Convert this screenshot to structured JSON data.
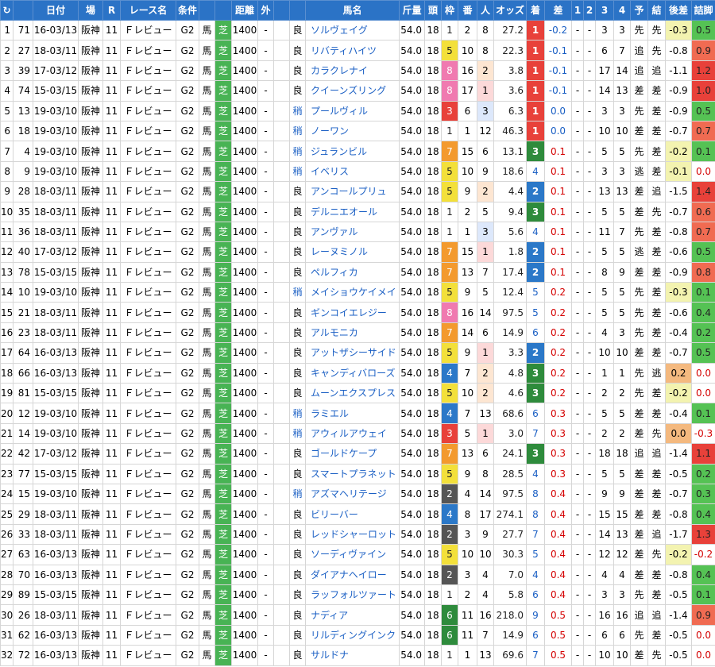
{
  "header": {
    "refresh_icon": "↻",
    "cols": [
      "",
      "日付",
      "場",
      "R",
      "レース名",
      "条件",
      "",
      "",
      "距離",
      "外",
      "",
      "馬名",
      "斤量",
      "頭",
      "枠",
      "番",
      "人",
      "オッズ",
      "着",
      "差",
      "1",
      "2",
      "3",
      "4",
      "予",
      "結",
      "後差",
      "詰脚"
    ]
  },
  "colors": {
    "header_bg": "#2b73c6",
    "turf": "#48b354",
    "win": "#e8413a",
    "place2": "#2b78c8",
    "place3": "#2e8b3c"
  },
  "rows": [
    [
      "1",
      "71",
      "16-03/13",
      "阪神",
      "11",
      "Ｆレビュー",
      "G2",
      "馬",
      "芝",
      "1400",
      "-",
      "",
      "良",
      "ソルヴェイグ",
      "54.0",
      "18",
      "1",
      "2",
      "8",
      "27.2",
      "1",
      "-0.2",
      "-",
      "-",
      "3",
      "3",
      "先",
      "先",
      "-0.3",
      "0.5"
    ],
    [
      "2",
      "27",
      "18-03/11",
      "阪神",
      "11",
      "Ｆレビュー",
      "G2",
      "馬",
      "芝",
      "1400",
      "-",
      "",
      "良",
      "リバティハイツ",
      "54.0",
      "18",
      "5",
      "10",
      "8",
      "22.3",
      "1",
      "-0.1",
      "-",
      "-",
      "6",
      "7",
      "追",
      "先",
      "-0.8",
      "0.9"
    ],
    [
      "3",
      "39",
      "17-03/12",
      "阪神",
      "11",
      "Ｆレビュー",
      "G2",
      "馬",
      "芝",
      "1400",
      "-",
      "",
      "良",
      "カラクレナイ",
      "54.0",
      "18",
      "8",
      "16",
      "2",
      "3.8",
      "1",
      "-0.1",
      "-",
      "-",
      "17",
      "14",
      "追",
      "追",
      "-1.1",
      "1.2"
    ],
    [
      "4",
      "74",
      "15-03/15",
      "阪神",
      "11",
      "Ｆレビュー",
      "G2",
      "馬",
      "芝",
      "1400",
      "-",
      "",
      "良",
      "クイーンズリング",
      "54.0",
      "18",
      "8",
      "17",
      "1",
      "3.6",
      "1",
      "-0.1",
      "-",
      "-",
      "14",
      "13",
      "差",
      "差",
      "-0.9",
      "1.0"
    ],
    [
      "5",
      "13",
      "19-03/10",
      "阪神",
      "11",
      "Ｆレビュー",
      "G2",
      "馬",
      "芝",
      "1400",
      "-",
      "",
      "稍",
      "プールヴィル",
      "54.0",
      "18",
      "3",
      "6",
      "3",
      "6.3",
      "1",
      "0.0",
      "-",
      "-",
      "3",
      "3",
      "先",
      "差",
      "-0.9",
      "0.5"
    ],
    [
      "6",
      "18",
      "19-03/10",
      "阪神",
      "11",
      "Ｆレビュー",
      "G2",
      "馬",
      "芝",
      "1400",
      "-",
      "",
      "稍",
      "ノーワン",
      "54.0",
      "18",
      "1",
      "1",
      "12",
      "46.3",
      "1",
      "0.0",
      "-",
      "-",
      "10",
      "10",
      "差",
      "差",
      "-0.7",
      "0.7"
    ],
    [
      "7",
      "4",
      "19-03/10",
      "阪神",
      "11",
      "Ｆレビュー",
      "G2",
      "馬",
      "芝",
      "1400",
      "-",
      "",
      "稍",
      "ジュランビル",
      "54.0",
      "18",
      "7",
      "15",
      "6",
      "13.1",
      "3",
      "0.1",
      "-",
      "-",
      "5",
      "5",
      "先",
      "差",
      "-0.2",
      "0.1"
    ],
    [
      "8",
      "9",
      "19-03/10",
      "阪神",
      "11",
      "Ｆレビュー",
      "G2",
      "馬",
      "芝",
      "1400",
      "-",
      "",
      "稍",
      "イベリス",
      "54.0",
      "18",
      "5",
      "10",
      "9",
      "18.6",
      "4",
      "0.1",
      "-",
      "-",
      "3",
      "3",
      "逃",
      "差",
      "-0.1",
      "0.0"
    ],
    [
      "9",
      "28",
      "18-03/11",
      "阪神",
      "11",
      "Ｆレビュー",
      "G2",
      "馬",
      "芝",
      "1400",
      "-",
      "",
      "良",
      "アンコールプリュ",
      "54.0",
      "18",
      "5",
      "9",
      "2",
      "4.4",
      "2",
      "0.1",
      "-",
      "-",
      "13",
      "13",
      "差",
      "追",
      "-1.5",
      "1.4"
    ],
    [
      "10",
      "35",
      "18-03/11",
      "阪神",
      "11",
      "Ｆレビュー",
      "G2",
      "馬",
      "芝",
      "1400",
      "-",
      "",
      "良",
      "デルニエオール",
      "54.0",
      "18",
      "1",
      "2",
      "5",
      "9.4",
      "3",
      "0.1",
      "-",
      "-",
      "5",
      "5",
      "差",
      "先",
      "-0.7",
      "0.6"
    ],
    [
      "11",
      "36",
      "18-03/11",
      "阪神",
      "11",
      "Ｆレビュー",
      "G2",
      "馬",
      "芝",
      "1400",
      "-",
      "",
      "良",
      "アンヴァル",
      "54.0",
      "18",
      "1",
      "1",
      "3",
      "5.6",
      "4",
      "0.1",
      "-",
      "-",
      "11",
      "7",
      "先",
      "差",
      "-0.8",
      "0.7"
    ],
    [
      "12",
      "40",
      "17-03/12",
      "阪神",
      "11",
      "Ｆレビュー",
      "G2",
      "馬",
      "芝",
      "1400",
      "-",
      "",
      "良",
      "レーヌミノル",
      "54.0",
      "18",
      "7",
      "15",
      "1",
      "1.8",
      "2",
      "0.1",
      "-",
      "-",
      "5",
      "5",
      "逃",
      "差",
      "-0.6",
      "0.5"
    ],
    [
      "13",
      "78",
      "15-03/15",
      "阪神",
      "11",
      "Ｆレビュー",
      "G2",
      "馬",
      "芝",
      "1400",
      "-",
      "",
      "良",
      "ペルフィカ",
      "54.0",
      "18",
      "7",
      "13",
      "7",
      "17.4",
      "2",
      "0.1",
      "-",
      "-",
      "8",
      "9",
      "差",
      "差",
      "-0.9",
      "0.8"
    ],
    [
      "14",
      "10",
      "19-03/10",
      "阪神",
      "11",
      "Ｆレビュー",
      "G2",
      "馬",
      "芝",
      "1400",
      "-",
      "",
      "稍",
      "メイショウケイメイ",
      "54.0",
      "18",
      "5",
      "9",
      "5",
      "12.4",
      "5",
      "0.2",
      "-",
      "-",
      "5",
      "5",
      "先",
      "差",
      "-0.3",
      "0.1"
    ],
    [
      "15",
      "21",
      "18-03/11",
      "阪神",
      "11",
      "Ｆレビュー",
      "G2",
      "馬",
      "芝",
      "1400",
      "-",
      "",
      "良",
      "ギンコイエレジー",
      "54.0",
      "18",
      "8",
      "16",
      "14",
      "97.5",
      "5",
      "0.2",
      "-",
      "-",
      "5",
      "5",
      "先",
      "差",
      "-0.6",
      "0.4"
    ],
    [
      "16",
      "23",
      "18-03/11",
      "阪神",
      "11",
      "Ｆレビュー",
      "G2",
      "馬",
      "芝",
      "1400",
      "-",
      "",
      "良",
      "アルモニカ",
      "54.0",
      "18",
      "7",
      "14",
      "6",
      "14.9",
      "6",
      "0.2",
      "-",
      "-",
      "4",
      "3",
      "先",
      "差",
      "-0.4",
      "0.2"
    ],
    [
      "17",
      "64",
      "16-03/13",
      "阪神",
      "11",
      "Ｆレビュー",
      "G2",
      "馬",
      "芝",
      "1400",
      "-",
      "",
      "良",
      "アットザシーサイド",
      "54.0",
      "18",
      "5",
      "9",
      "1",
      "3.3",
      "2",
      "0.2",
      "-",
      "-",
      "10",
      "10",
      "差",
      "差",
      "-0.7",
      "0.5"
    ],
    [
      "18",
      "66",
      "16-03/13",
      "阪神",
      "11",
      "Ｆレビュー",
      "G2",
      "馬",
      "芝",
      "1400",
      "-",
      "",
      "良",
      "キャンディバローズ",
      "54.0",
      "18",
      "4",
      "7",
      "2",
      "4.8",
      "3",
      "0.2",
      "-",
      "-",
      "1",
      "1",
      "先",
      "逃",
      "0.2",
      "0.0"
    ],
    [
      "19",
      "81",
      "15-03/15",
      "阪神",
      "11",
      "Ｆレビュー",
      "G2",
      "馬",
      "芝",
      "1400",
      "-",
      "",
      "良",
      "ムーンエクスプレス",
      "54.0",
      "18",
      "5",
      "10",
      "2",
      "4.6",
      "3",
      "0.2",
      "-",
      "-",
      "2",
      "2",
      "先",
      "差",
      "-0.2",
      "0.0"
    ],
    [
      "20",
      "12",
      "19-03/10",
      "阪神",
      "11",
      "Ｆレビュー",
      "G2",
      "馬",
      "芝",
      "1400",
      "-",
      "",
      "稍",
      "ラミエル",
      "54.0",
      "18",
      "4",
      "7",
      "13",
      "68.6",
      "6",
      "0.3",
      "-",
      "-",
      "5",
      "5",
      "差",
      "差",
      "-0.4",
      "0.1"
    ],
    [
      "21",
      "14",
      "19-03/10",
      "阪神",
      "11",
      "Ｆレビュー",
      "G2",
      "馬",
      "芝",
      "1400",
      "-",
      "",
      "稍",
      "アウィルアウェイ",
      "54.0",
      "18",
      "3",
      "5",
      "1",
      "3.0",
      "7",
      "0.3",
      "-",
      "-",
      "2",
      "2",
      "差",
      "先",
      "0.0",
      "-0.3"
    ],
    [
      "22",
      "42",
      "17-03/12",
      "阪神",
      "11",
      "Ｆレビュー",
      "G2",
      "馬",
      "芝",
      "1400",
      "-",
      "",
      "良",
      "ゴールドケープ",
      "54.0",
      "18",
      "7",
      "13",
      "6",
      "24.1",
      "3",
      "0.3",
      "-",
      "-",
      "18",
      "18",
      "追",
      "追",
      "-1.4",
      "1.1"
    ],
    [
      "23",
      "77",
      "15-03/15",
      "阪神",
      "11",
      "Ｆレビュー",
      "G2",
      "馬",
      "芝",
      "1400",
      "-",
      "",
      "良",
      "スマートプラネット",
      "54.0",
      "18",
      "5",
      "9",
      "8",
      "28.5",
      "4",
      "0.3",
      "-",
      "-",
      "5",
      "5",
      "差",
      "差",
      "-0.5",
      "0.2"
    ],
    [
      "24",
      "15",
      "19-03/10",
      "阪神",
      "11",
      "Ｆレビュー",
      "G2",
      "馬",
      "芝",
      "1400",
      "-",
      "",
      "稍",
      "アズマヘリテージ",
      "54.0",
      "18",
      "2",
      "4",
      "14",
      "97.5",
      "8",
      "0.4",
      "-",
      "-",
      "9",
      "9",
      "差",
      "差",
      "-0.7",
      "0.3"
    ],
    [
      "25",
      "29",
      "18-03/11",
      "阪神",
      "11",
      "Ｆレビュー",
      "G2",
      "馬",
      "芝",
      "1400",
      "-",
      "",
      "良",
      "ビリーバー",
      "54.0",
      "18",
      "4",
      "8",
      "17",
      "274.1",
      "8",
      "0.4",
      "-",
      "-",
      "15",
      "15",
      "差",
      "差",
      "-0.8",
      "0.4"
    ],
    [
      "26",
      "33",
      "18-03/11",
      "阪神",
      "11",
      "Ｆレビュー",
      "G2",
      "馬",
      "芝",
      "1400",
      "-",
      "",
      "良",
      "レッドシャーロット",
      "54.0",
      "18",
      "2",
      "3",
      "9",
      "27.7",
      "7",
      "0.4",
      "-",
      "-",
      "14",
      "13",
      "差",
      "追",
      "-1.7",
      "1.3"
    ],
    [
      "27",
      "63",
      "16-03/13",
      "阪神",
      "11",
      "Ｆレビュー",
      "G2",
      "馬",
      "芝",
      "1400",
      "-",
      "",
      "良",
      "ソーディヴァイン",
      "54.0",
      "18",
      "5",
      "10",
      "10",
      "30.3",
      "5",
      "0.4",
      "-",
      "-",
      "12",
      "12",
      "差",
      "先",
      "-0.2",
      "-0.2"
    ],
    [
      "28",
      "70",
      "16-03/13",
      "阪神",
      "11",
      "Ｆレビュー",
      "G2",
      "馬",
      "芝",
      "1400",
      "-",
      "",
      "良",
      "ダイアナヘイロー",
      "54.0",
      "18",
      "2",
      "3",
      "4",
      "7.0",
      "4",
      "0.4",
      "-",
      "-",
      "4",
      "4",
      "差",
      "差",
      "-0.8",
      "0.4"
    ],
    [
      "29",
      "89",
      "15-03/15",
      "阪神",
      "11",
      "Ｆレビュー",
      "G2",
      "馬",
      "芝",
      "1400",
      "-",
      "",
      "良",
      "ラッフォルツァート",
      "54.0",
      "18",
      "1",
      "2",
      "4",
      "5.8",
      "6",
      "0.4",
      "-",
      "-",
      "3",
      "3",
      "先",
      "差",
      "-0.5",
      "0.1"
    ],
    [
      "30",
      "26",
      "18-03/11",
      "阪神",
      "11",
      "Ｆレビュー",
      "G2",
      "馬",
      "芝",
      "1400",
      "-",
      "",
      "良",
      "ナディア",
      "54.0",
      "18",
      "6",
      "11",
      "16",
      "218.0",
      "9",
      "0.5",
      "-",
      "-",
      "16",
      "16",
      "追",
      "追",
      "-1.4",
      "0.9"
    ],
    [
      "31",
      "62",
      "16-03/13",
      "阪神",
      "11",
      "Ｆレビュー",
      "G2",
      "馬",
      "芝",
      "1400",
      "-",
      "",
      "良",
      "リルディングインク",
      "54.0",
      "18",
      "6",
      "11",
      "7",
      "14.9",
      "6",
      "0.5",
      "-",
      "-",
      "6",
      "6",
      "先",
      "差",
      "-0.5",
      "0.0"
    ],
    [
      "32",
      "72",
      "16-03/13",
      "阪神",
      "11",
      "Ｆレビュー",
      "G2",
      "馬",
      "芝",
      "1400",
      "-",
      "",
      "良",
      "サルドナ",
      "54.0",
      "18",
      "1",
      "1",
      "13",
      "69.6",
      "7",
      "0.5",
      "-",
      "-",
      "10",
      "10",
      "差",
      "先",
      "-0.5",
      "0.0"
    ]
  ]
}
